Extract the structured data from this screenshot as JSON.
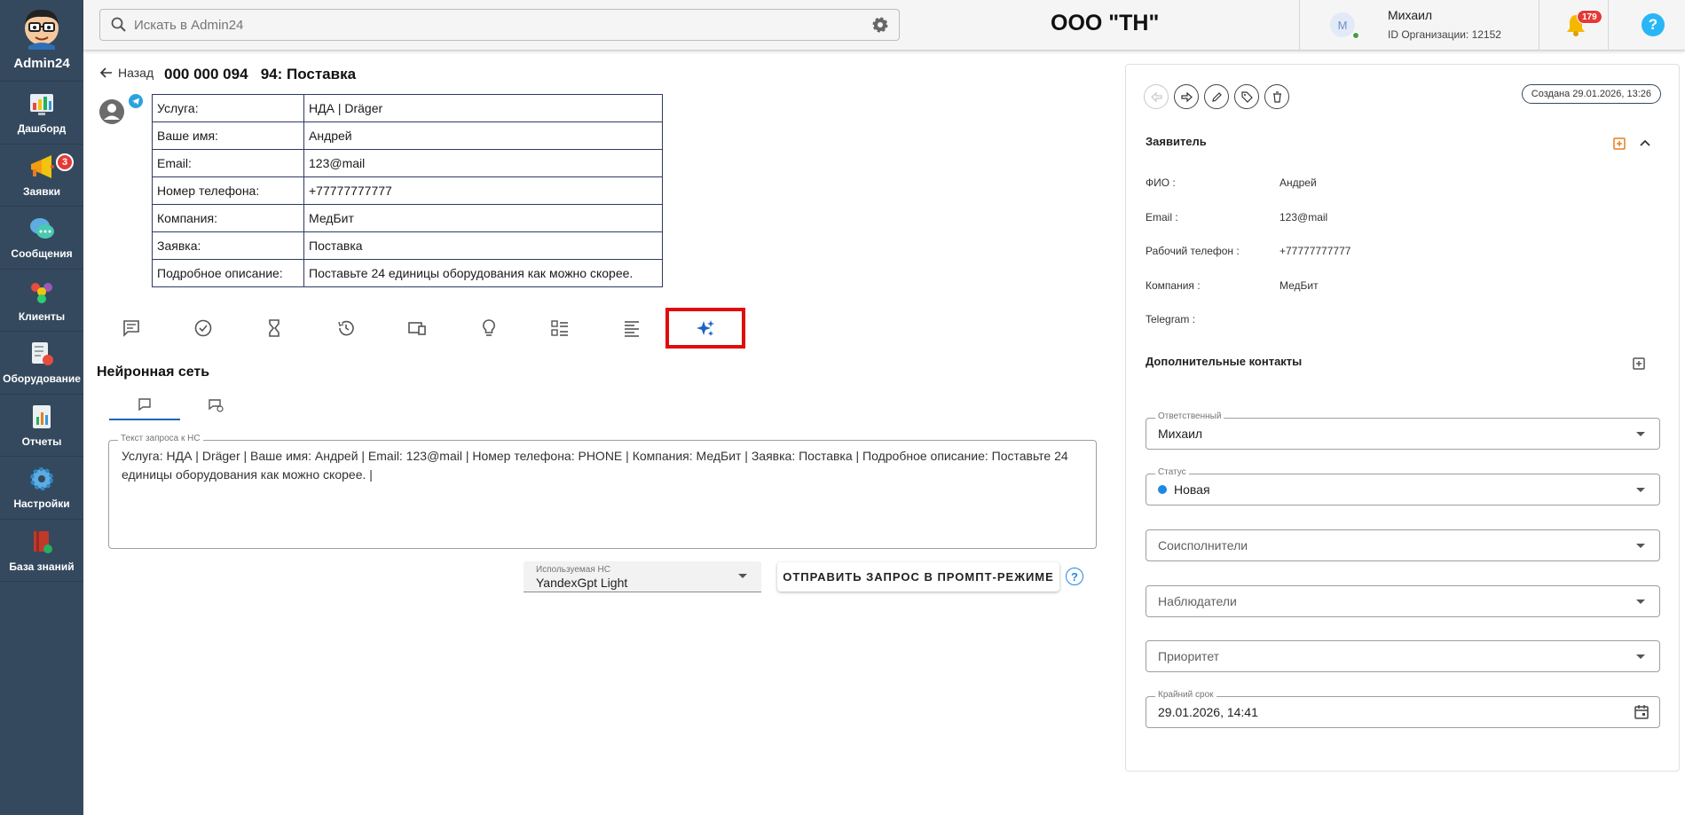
{
  "app": {
    "brand": "Admin24"
  },
  "sidebar": {
    "items": [
      {
        "label": "Дашборд",
        "icon": "dashboard-icon"
      },
      {
        "label": "Заявки",
        "icon": "megaphone-icon",
        "badge": "3"
      },
      {
        "label": "Сообщения",
        "icon": "chat-bubbles-icon"
      },
      {
        "label": "Клиенты",
        "icon": "clients-icon"
      },
      {
        "label": "Оборудование",
        "icon": "equipment-icon"
      },
      {
        "label": "Отчеты",
        "icon": "reports-icon"
      },
      {
        "label": "Настройки",
        "icon": "settings-gear-icon"
      },
      {
        "label": "База знаний",
        "icon": "knowledge-base-icon"
      }
    ]
  },
  "topbar": {
    "search_placeholder": "Искать в Admin24",
    "org_title": "ООО \"ТН\"",
    "user_initial": "М",
    "user_name": "Михаил",
    "org_id": "ID Организации: 12152",
    "notifications_count": "179",
    "help_label": "?"
  },
  "ticket": {
    "back_label": "Назад",
    "title": "000 000 094   94: Поставка",
    "fields": [
      {
        "key": "Услуга:",
        "value": "НДА | Dräger"
      },
      {
        "key": "Ваше имя:",
        "value": "Андрей"
      },
      {
        "key": "Email:",
        "value": "123@mail"
      },
      {
        "key": "Номер телефона:",
        "value": "+77777777777"
      },
      {
        "key": "Компания:",
        "value": "МедБит"
      },
      {
        "key": "Заявка:",
        "value": "Поставка"
      },
      {
        "key": "Подробное описание:",
        "value": "Поставьте 24 единицы оборудования как можно скорее."
      }
    ]
  },
  "toolbar": {
    "icons": [
      "comment-icon",
      "check-circle-icon",
      "hourglass-icon",
      "history-icon",
      "devices-icon",
      "lightbulb-icon",
      "checklist-icon",
      "text-align-icon",
      "ai-sparkles-icon"
    ],
    "active_index": 8
  },
  "neural": {
    "section_title": "Нейронная сеть",
    "prompt_legend": "Текст запроса к НС",
    "prompt_text": "Услуга: НДА | Dräger | Ваше имя: Андрей | Email: 123@mail | Номер телефона: PHONE | Компания: МедБит | Заявка: Поставка | Подробное описание: Поставьте 24 единицы оборудования как можно скорее. |",
    "model_label": "Используемая НС",
    "model_value": "YandexGpt Light",
    "send_button": "ОТПРАВИТЬ ЗАПРОС В ПРОМПТ-РЕЖИМЕ",
    "help_label": "?"
  },
  "right_panel": {
    "created": "Создана 29.01.2026, 13:26",
    "applicant_title": "Заявитель",
    "applicant": [
      {
        "key": "ФИО :",
        "value": "Андрей"
      },
      {
        "key": "Email :",
        "value": "123@mail"
      },
      {
        "key": "Рабочий телефон :",
        "value": "+77777777777"
      },
      {
        "key": "Компания :",
        "value": "МедБит"
      },
      {
        "key": "Telegram :",
        "value": ""
      }
    ],
    "extra_contacts_title": "Дополнительные контакты",
    "responsible_label": "Ответственный",
    "responsible_value": "Михаил",
    "status_label": "Статус",
    "status_value": "Новая",
    "status_color": "#1e88e5",
    "coexecutors_placeholder": "Соисполнители",
    "observers_placeholder": "Наблюдатели",
    "priority_placeholder": "Приоритет",
    "deadline_label": "Крайний срок",
    "deadline_value": "29.01.2026, 14:41"
  }
}
